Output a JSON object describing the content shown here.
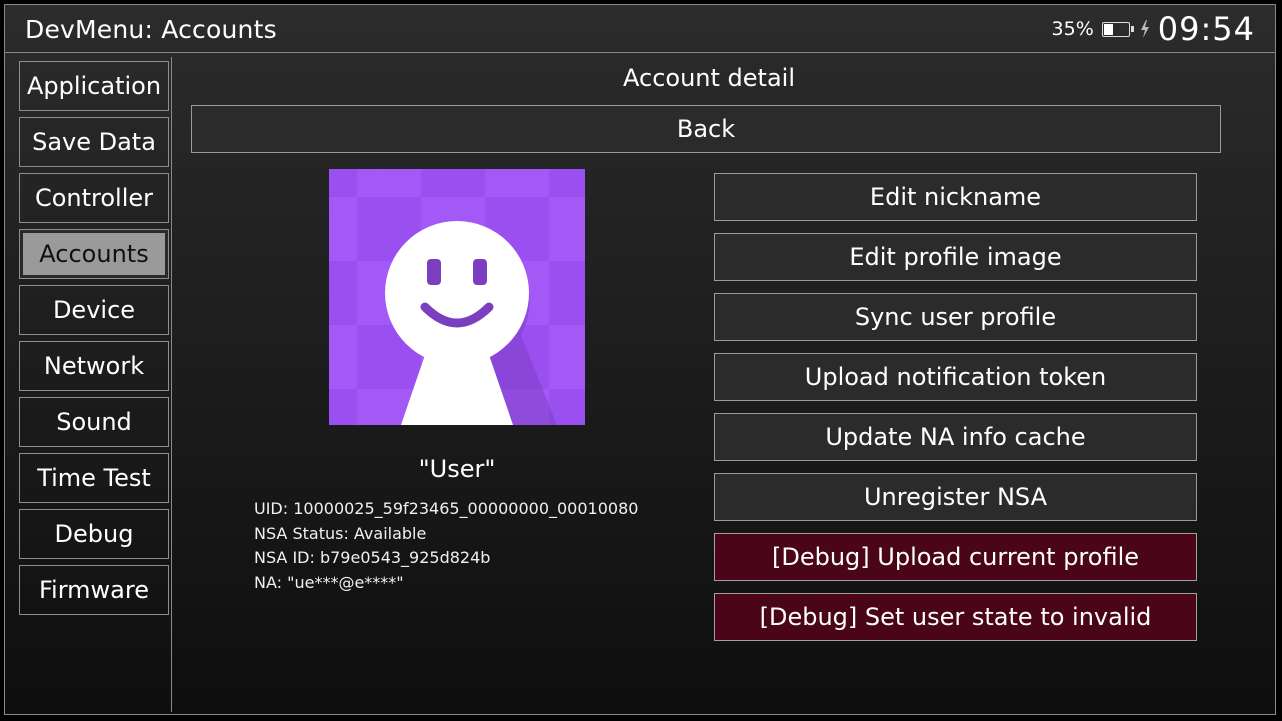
{
  "header": {
    "title": "DevMenu: Accounts",
    "battery_percent": "35%",
    "battery_level": 0.35,
    "clock": "09:54"
  },
  "sidebar": {
    "items": [
      {
        "label": "Application"
      },
      {
        "label": "Save Data"
      },
      {
        "label": "Controller"
      },
      {
        "label": "Accounts",
        "active": true
      },
      {
        "label": "Device"
      },
      {
        "label": "Network"
      },
      {
        "label": "Sound"
      },
      {
        "label": "Time Test"
      },
      {
        "label": "Debug"
      },
      {
        "label": "Firmware"
      }
    ]
  },
  "main": {
    "title": "Account detail",
    "back_label": "Back",
    "profile": {
      "nickname": "\"User\"",
      "uid": "UID: 10000025_59f23465_00000000_00010080",
      "nsa_status": "NSA Status: Available",
      "nsa_id": "NSA ID: b79e0543_925d824b",
      "na": "NA: \"ue***@e****\""
    },
    "actions": [
      {
        "label": "Edit nickname"
      },
      {
        "label": "Edit profile image"
      },
      {
        "label": "Sync user profile"
      },
      {
        "label": "Upload notification token"
      },
      {
        "label": "Update NA info cache"
      },
      {
        "label": "Unregister NSA"
      },
      {
        "label": "[Debug] Upload current profile",
        "debug": true
      },
      {
        "label": "[Debug] Set user state to invalid",
        "debug": true
      }
    ]
  },
  "colors": {
    "avatar_bg": "#a259f5",
    "avatar_accent": "#7a3fbf",
    "debug_button": "#4a0518",
    "active_nav": "#9a9a9a"
  }
}
